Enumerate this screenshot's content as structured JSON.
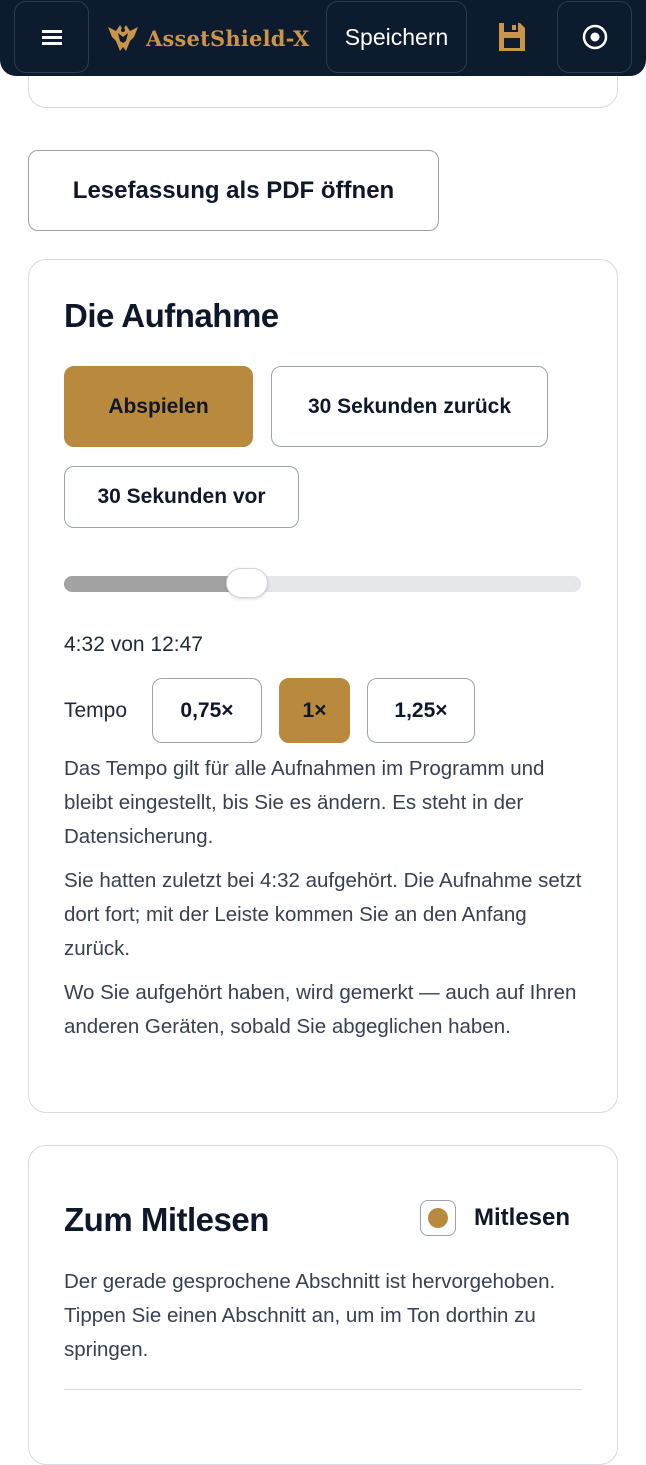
{
  "header": {
    "brand_name": "AssetShield-X",
    "save_label": "Speichern",
    "icons": {
      "menu": "hamburger-menu-icon",
      "logo": "eagle-crest-logo",
      "save": "floppy-disk-icon",
      "target": "record-target-icon"
    },
    "colors": {
      "bar": "#0d1b2e",
      "brand": "#c9954a",
      "accent": "#b98a3e"
    }
  },
  "pdf_button_label": "Lesefassung als PDF öffnen",
  "audio": {
    "title": "Die Aufnahme",
    "play_label": "Abspielen",
    "back_label": "30 Sekunden zurück",
    "forward_label": "30 Sekunden vor",
    "progress_fraction": 0.3545,
    "time_text": "4:32 von 12:47",
    "tempo_label": "Tempo",
    "speeds": [
      "0,75×",
      "1×",
      "1,25×"
    ],
    "selected_speed": "1×",
    "paragraphs": [
      "Das Tempo gilt für alle Aufnahmen im Programm und bleibt eingestellt, bis Sie es ändern. Es steht in der Datensicherung.",
      "Sie hatten zuletzt bei 4:32 aufgehört. Die Aufnahme setzt dort fort; mit der Leiste kommen Sie an den Anfang zurück.",
      "Wo Sie aufgehört haben, wird gemerkt — auch auf Ihren anderen Geräten, sobald Sie abgeglichen haben."
    ]
  },
  "read_along": {
    "title": "Zum Mitlesen",
    "toggle_label": "Mitlesen",
    "toggle_checked": true,
    "description": "Der gerade gesprochene Abschnitt ist hervorgehoben. Tippen Sie einen Abschnitt an, um im Ton dorthin zu springen."
  }
}
